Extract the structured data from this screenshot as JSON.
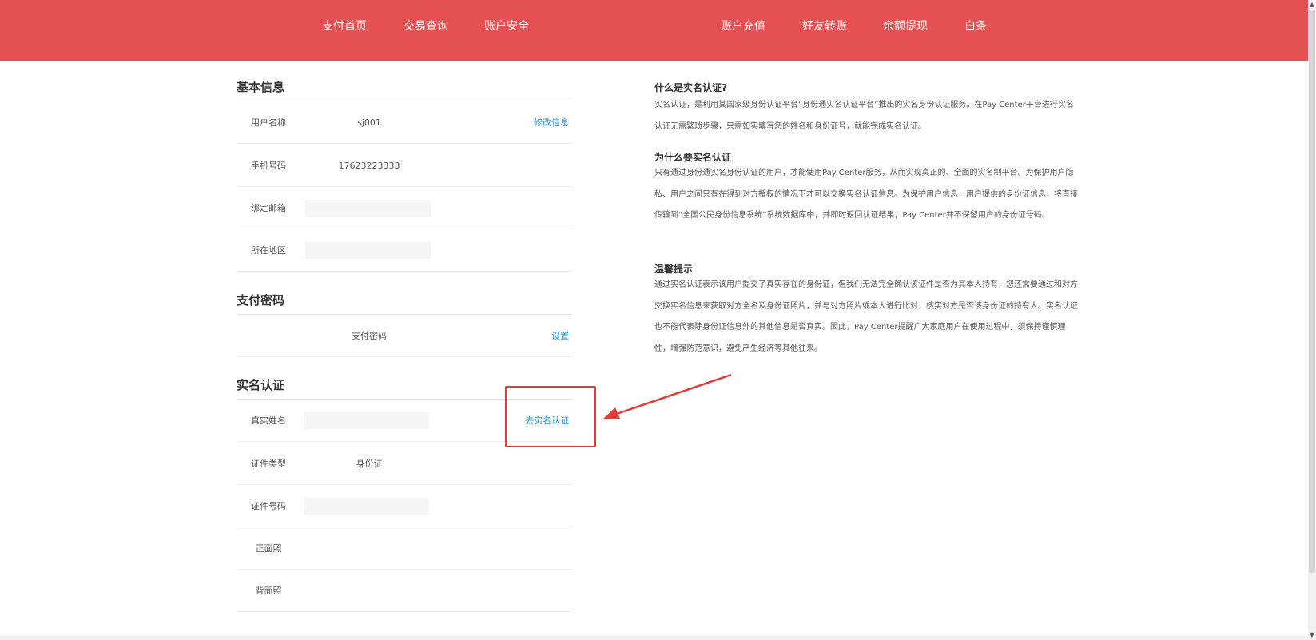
{
  "nav": {
    "left": [
      "支付首页",
      "交易查询",
      "账户安全"
    ],
    "right": [
      "账户充值",
      "好友转账",
      "余额提现",
      "白条"
    ]
  },
  "basic_info": {
    "title": "基本信息",
    "username": {
      "label": "用户名称",
      "value": "sj001",
      "action": "修改信息"
    },
    "phone": {
      "label": "手机号码",
      "value": "17623223333"
    },
    "email": {
      "label": "绑定邮箱",
      "value": ""
    },
    "region": {
      "label": "所在地区",
      "value": ""
    }
  },
  "pay_password": {
    "title": "支付密码",
    "label": "支付密码",
    "action": "设置"
  },
  "real_name": {
    "title": "实名认证",
    "real_name": {
      "label": "真实姓名",
      "value": "",
      "action": "去实名认证"
    },
    "id_type": {
      "label": "证件类型",
      "value": "身份证"
    },
    "id_number": {
      "label": "证件号码",
      "value": ""
    },
    "front_photo": {
      "label": "正面照"
    },
    "back_photo": {
      "label": "背面照"
    }
  },
  "faq": [
    {
      "title": "什么是实名认证?",
      "body": "实名认证，是利用其国家级身份认证平台“身份通实名认证平台”推出的实名身份认证服务。在Pay Center平台进行实名认证无需繁琐步骤，只需如实填写您的姓名和身份证号，就能完成实名认证。"
    },
    {
      "title": "为什么要实名认证",
      "body": "只有通过身份通实名身份认证的用户，才能使用Pay Center服务，从而实现真正的、全面的实名制平台。为保护用户隐私、用户之间只有在得到对方授权的情况下才可以交换实名认证信息。为保护用户信息，用户提供的身份证信息，将直接传输到“全国公民身份信息系统”系统数据库中，并即时返回认证结果，Pay Center并不保留用户的身份证号码。"
    },
    {
      "title": "温馨提示",
      "body": "通过实名认证表示该用户提交了真实存在的身份证，但我们无法完全确认该证件是否为其本人持有，您还需要通过和对方交换实名信息来获取对方全名及身份证照片，并与对方照片或本人进行比对，核实对方是否该身份证的持有人。实名认证也不能代表除身份证信息外的其他信息是否真实。因此，Pay Center提醒广大家庭用户在使用过程中，须保持谨慎理性，增强防范意识，避免产生经济等其他往来。"
    }
  ],
  "colors": {
    "nav_bg": "#e55152",
    "link": "#2a8fd1",
    "annotation": "#e53935"
  }
}
